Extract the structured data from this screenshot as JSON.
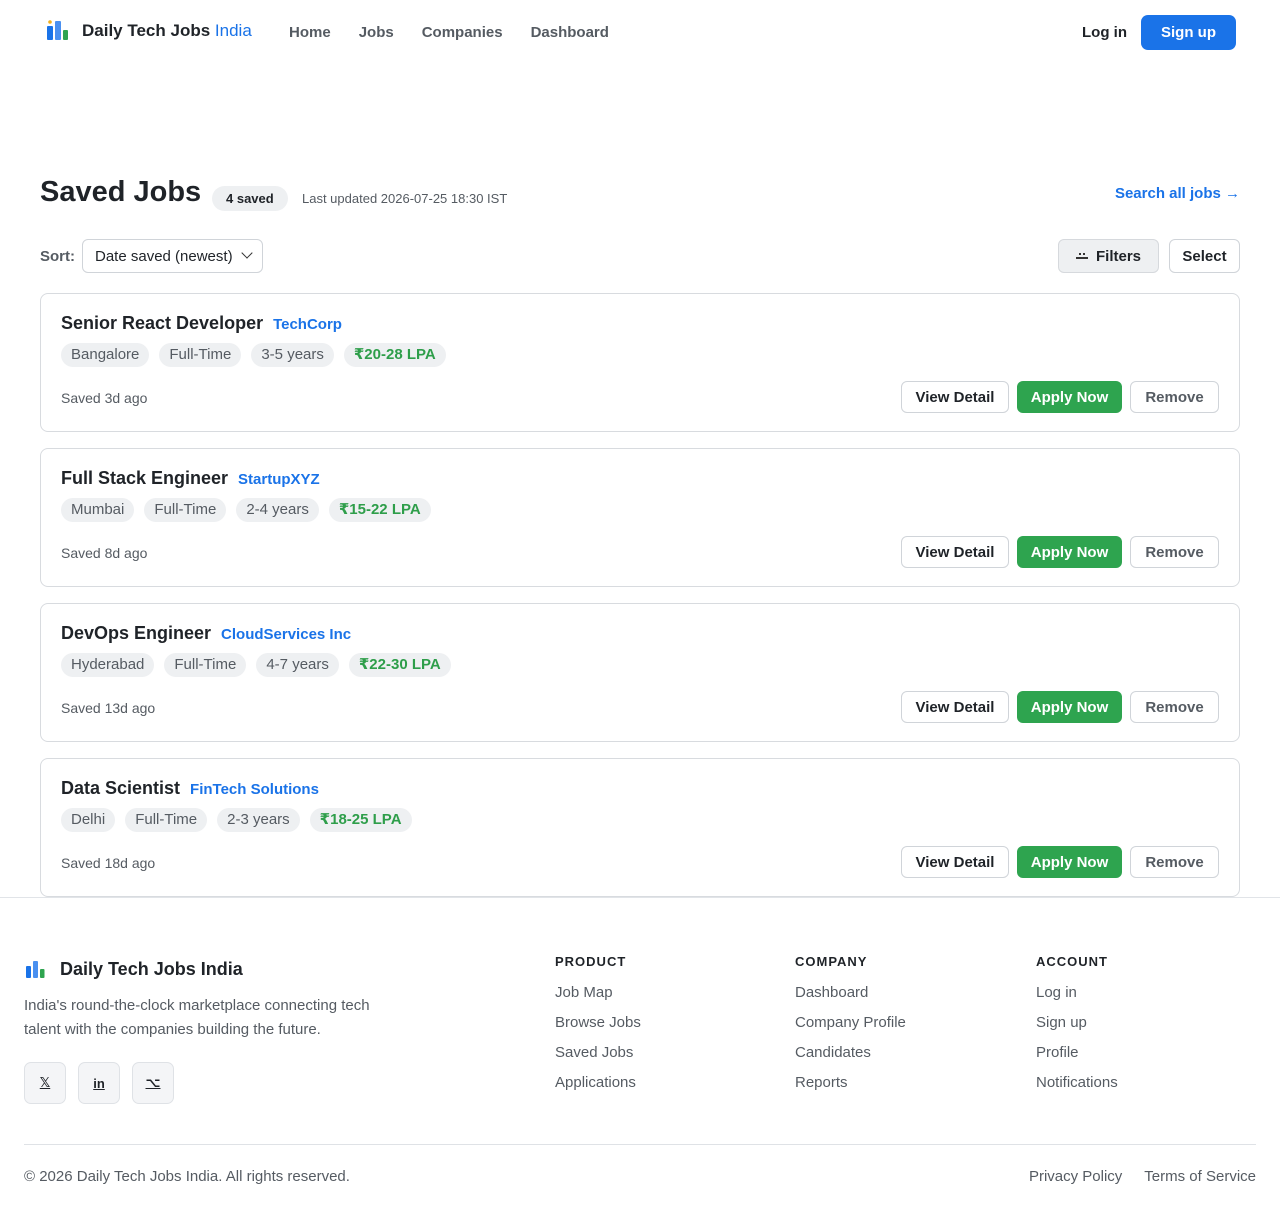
{
  "header": {
    "brand_main": "Daily Tech Jobs",
    "brand_accent": "India",
    "nav": [
      {
        "label": "Home"
      },
      {
        "label": "Jobs"
      },
      {
        "label": "Companies"
      },
      {
        "label": "Dashboard"
      }
    ],
    "login_label": "Log in",
    "signup_label": "Sign up"
  },
  "page": {
    "title": "Saved Jobs",
    "saved_badge": "4 saved",
    "last_updated": "Last updated 2026-07-25 18:30 IST",
    "search_all_label": "Search all jobs →"
  },
  "controls": {
    "sort_label": "Sort:",
    "sort_value": "Date saved (newest)",
    "filters_label": "Filters",
    "select_label": "Select"
  },
  "jobs": [
    {
      "title": "Senior React Developer",
      "company": "TechCorp",
      "location": "Bangalore",
      "type": "Full-Time",
      "experience": "3-5 years",
      "salary": "₹20-28 LPA",
      "saved": "Saved 3d ago"
    },
    {
      "title": "Full Stack Engineer",
      "company": "StartupXYZ",
      "location": "Mumbai",
      "type": "Full-Time",
      "experience": "2-4 years",
      "salary": "₹15-22 LPA",
      "saved": "Saved 8d ago"
    },
    {
      "title": "DevOps Engineer",
      "company": "CloudServices Inc",
      "location": "Hyderabad",
      "type": "Full-Time",
      "experience": "4-7 years",
      "salary": "₹22-30 LPA",
      "saved": "Saved 13d ago"
    },
    {
      "title": "Data Scientist",
      "company": "FinTech Solutions",
      "location": "Delhi",
      "type": "Full-Time",
      "experience": "2-3 years",
      "salary": "₹18-25 LPA",
      "saved": "Saved 18d ago"
    }
  ],
  "card_actions": {
    "view_label": "View Detail",
    "apply_label": "Apply Now",
    "remove_label": "Remove"
  },
  "footer": {
    "brand": "Daily Tech Jobs India",
    "description": "India's round-the-clock marketplace connecting tech talent with the companies building the future.",
    "socials": [
      {
        "label": "𝕏",
        "icon": "x-icon"
      },
      {
        "label": "in",
        "icon": "linkedin-icon"
      },
      {
        "label": "⌥",
        "icon": "github-icon"
      }
    ],
    "columns": [
      {
        "heading": "PRODUCT",
        "links": [
          "Job Map",
          "Browse Jobs",
          "Saved Jobs",
          "Applications"
        ]
      },
      {
        "heading": "COMPANY",
        "links": [
          "Dashboard",
          "Company Profile",
          "Candidates",
          "Reports"
        ]
      },
      {
        "heading": "ACCOUNT",
        "links": [
          "Log in",
          "Sign up",
          "Profile",
          "Notifications"
        ]
      }
    ],
    "copyright": "© 2026 Daily Tech Jobs India. All rights reserved.",
    "legal": [
      "Privacy Policy",
      "Terms of Service"
    ]
  },
  "colors": {
    "primary": "#1a73e8",
    "success": "#2ea44f",
    "salary": "#2e9e4a",
    "text": "#1f2328",
    "muted": "#555b62"
  }
}
